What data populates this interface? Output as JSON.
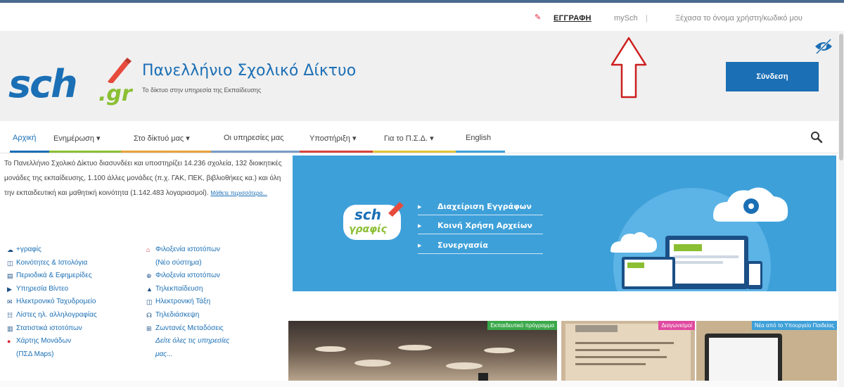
{
  "topbar": {
    "register_label": "ΕΓΓΡΑΦΗ",
    "mysch_label": "mySch",
    "separator": "|",
    "forgot_label": "Ξέχασα το όνομα χρήστη/κωδικό μου"
  },
  "header": {
    "logo_sch": "sch",
    "logo_gr": ".gr",
    "title": "Πανελλήνιο Σχολικό Δίκτυο",
    "subtitle": "Το δίκτυο στην υπηρεσία της Εκπαίδευσης",
    "login_label": "Σύνδεση"
  },
  "nav": {
    "items": [
      {
        "label": "Αρχική"
      },
      {
        "label": "Ενημέρωση ▾"
      },
      {
        "label": "Στο δίκτυό μας ▾"
      },
      {
        "label": "Οι υπηρεσίες μας"
      },
      {
        "label": "Υποστήριξη ▾"
      },
      {
        "label": "Για το Π.Σ.Δ. ▾"
      },
      {
        "label": "English"
      }
    ],
    "colors": [
      "#1b6fb5",
      "#8bbf33",
      "#e8a23a",
      "#7a9cc6",
      "#d6453d",
      "#e0c43a",
      "#3ea0d9"
    ]
  },
  "intro": {
    "text": "Το Πανελλήνιο Σχολικό Δίκτυο διασυνδέει και υποστηρίζει 14.236 σχολεία, 132 διοικητικές μονάδες της εκπαίδευσης, 1.100 άλλες μονάδες (π.χ. ΓΑΚ, ΠΕΚ, βιβλιοθήκες κα.) και όλη την εκπαιδευτική και μαθητική κοινότητα (1.142.483 λογαριασμοί).",
    "more": "Μάθετε περισσότερα..."
  },
  "links_left": [
    {
      "icon": "☁",
      "label": "+γραφίς"
    },
    {
      "icon": "◫",
      "label": "Κοινότητες & Ιστολόγια"
    },
    {
      "icon": "▤",
      "label": "Περιοδικά & Εφημερίδες"
    },
    {
      "icon": "▶",
      "label": "Υπηρεσία Βίντεο"
    },
    {
      "icon": "✉",
      "label": "Ηλεκτρονικό Ταχυδρομείο"
    },
    {
      "icon": "☷",
      "label": "Λίστες ηλ. αλληλογραφίας"
    },
    {
      "icon": "▥",
      "label": "Στατιστικά ιστοτόπων"
    },
    {
      "icon": "●",
      "label": "Χάρτης Μονάδων"
    },
    {
      "icon": "",
      "label": "(ΠΣΔ Maps)"
    }
  ],
  "links_right": [
    {
      "icon": "⌂",
      "label": "Φιλοξενία ιστοτόπων"
    },
    {
      "icon": "",
      "label": "(Νέο σύστημα)"
    },
    {
      "icon": "⊕",
      "label": "Φιλοξενία ιστοτόπων"
    },
    {
      "icon": "▲",
      "label": "Τηλεκπαίδευση"
    },
    {
      "icon": "◫",
      "label": "Ηλεκτρονική Τάξη"
    },
    {
      "icon": "☊",
      "label": "Τηλεδιάσκεψη"
    },
    {
      "icon": "⊞",
      "label": "Ζωντανές Μεταδόσεις"
    },
    {
      "icon": "",
      "label": "Δείτε όλες τις υπηρεσίες"
    },
    {
      "icon": "",
      "label": "μας..."
    }
  ],
  "banner": {
    "logo_top": "sch",
    "logo_bottom": "γραφίς",
    "items": [
      "Διαχείριση Εγγράφων",
      "Κοινή Χρήση Αρχείων",
      "Συνεργασία"
    ],
    "bg_color": "#3ea0d9"
  },
  "tiles": [
    {
      "badge": "Εκπαιδευτικό πρόγραμμα",
      "badge_color": "#3aa84a"
    },
    {
      "badge": "Διαγωνισμοί",
      "badge_color": "#e04aa0"
    },
    {
      "badge": "Νέα από το Υπουργείο Παιδείας",
      "badge_color": "#3ea0d9"
    }
  ]
}
